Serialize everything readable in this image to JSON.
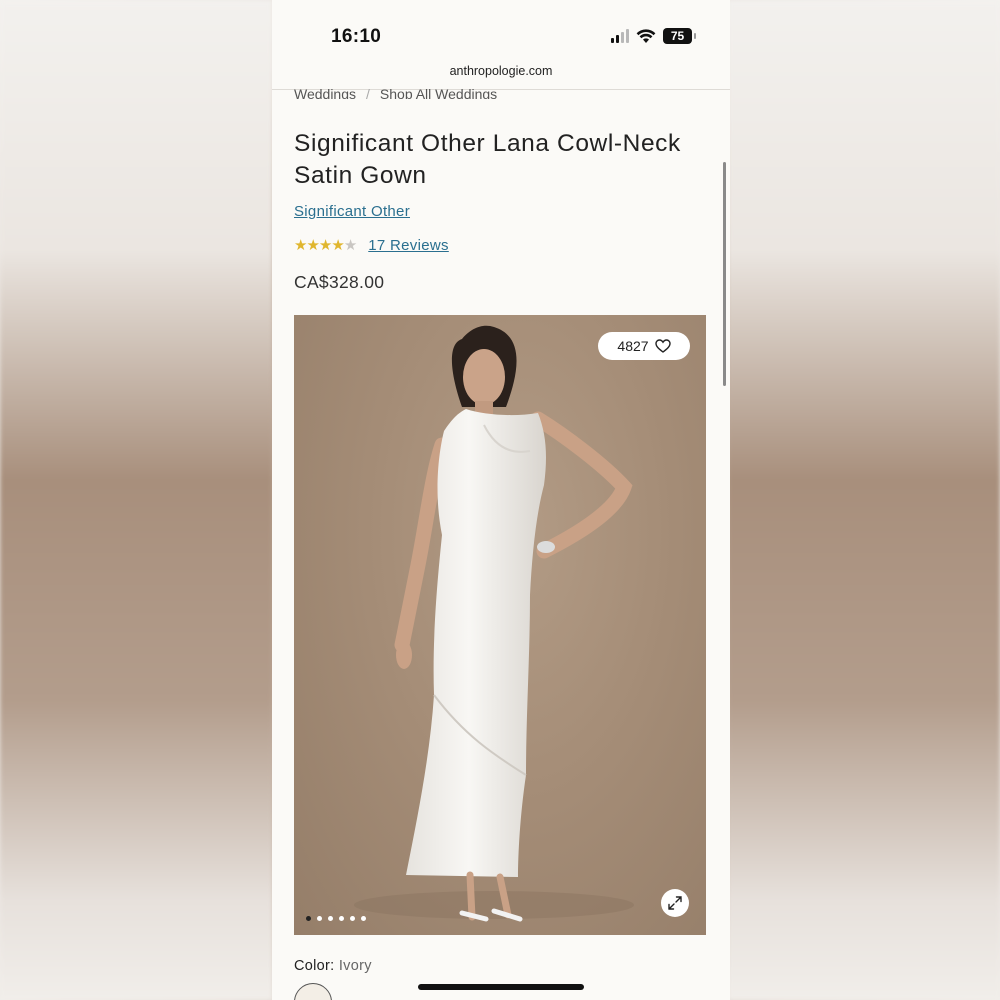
{
  "status_bar": {
    "time": "16:10",
    "battery": "75",
    "icons": [
      "signal-icon",
      "wifi-icon",
      "battery-icon"
    ]
  },
  "browser": {
    "url": "anthropologie.com"
  },
  "breadcrumb": [
    "Weddings",
    "Shop All Weddings"
  ],
  "product": {
    "title": "Significant Other Lana Cowl-Neck Satin Gown",
    "brand": "Significant Other",
    "rating_stars": 4,
    "rating_max": 5,
    "reviews_label": "17 Reviews",
    "price": "CA$328.00"
  },
  "gallery": {
    "likes": "4827",
    "image_count": 6,
    "active_index": 0,
    "icons": [
      "heart-icon",
      "expand-icon"
    ]
  },
  "options": {
    "color_label": "Color:",
    "color_value": "Ivory"
  },
  "colors": {
    "link": "#2a6f8f",
    "star": "#e0b62e",
    "page_bg": "#fbfaf7"
  }
}
